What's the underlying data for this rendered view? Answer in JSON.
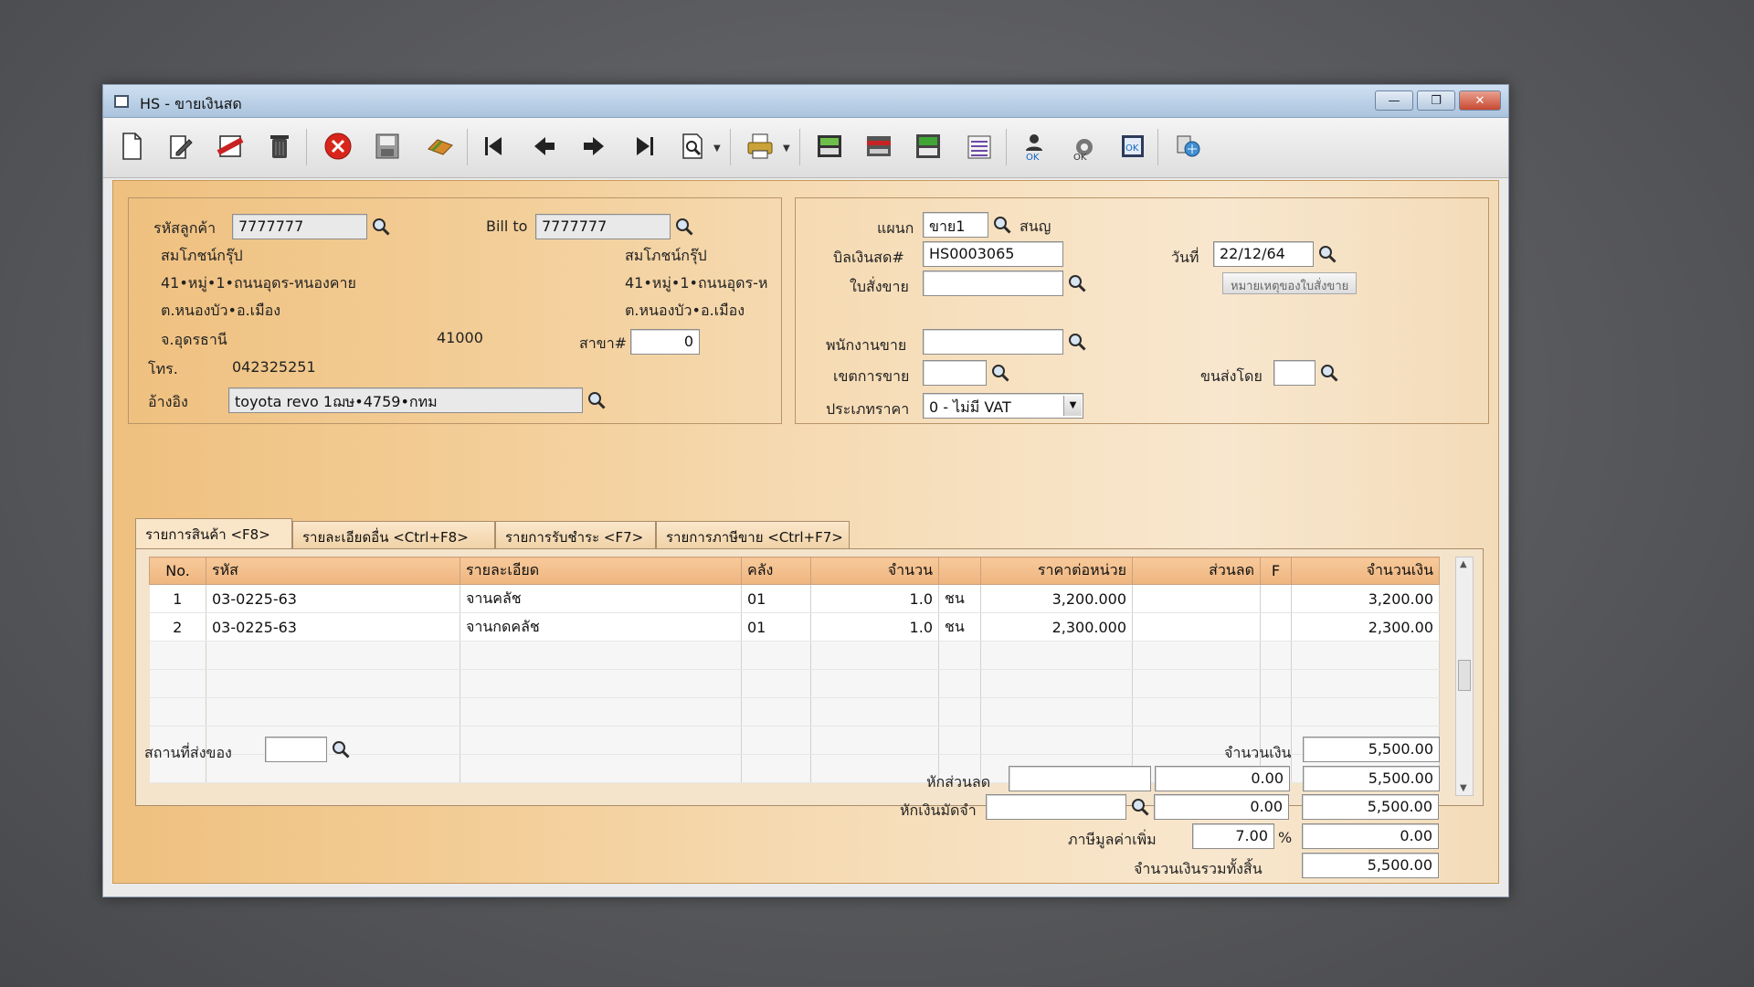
{
  "window": {
    "title": "HS - ขายเงินสด"
  },
  "window_buttons": {
    "minimize": "—",
    "maximize": "❐",
    "close": "✕"
  },
  "customer": {
    "code_label": "รหัสลูกค้า",
    "code": "7777777",
    "name": "สมโภชน์กรุ๊ป",
    "address1": "41•หมู่•1•ถนนอุดร-หนองคาย",
    "address2": "ต.หนองบัว•อ.เมือง",
    "province": "จ.อุดรธานี",
    "postcode": "41000",
    "phone_label": "โทร.",
    "phone": "042325251",
    "ref_label": "อ้างอิง",
    "ref": "toyota revo 1ฌษ•4759•กทม"
  },
  "bill_to": {
    "label": "Bill to",
    "code": "7777777",
    "name": "สมโภชน์กรุ๊ป",
    "address1": "41•หมู่•1•ถนนอุดร-ห",
    "address2": "ต.หนองบัว•อ.เมือง",
    "branch_label": "สาขา#",
    "branch": "0"
  },
  "doc": {
    "dept_label": "แผนก",
    "dept": "ขาย1",
    "dept_name": "สนญ",
    "bill_label": "บิลเงินสด#",
    "bill_no": "HS0003065",
    "date_label": "วันที่",
    "date": "22/12/64",
    "order_label": "ใบสั่งขาย",
    "order": "",
    "order_note_btn": "หมายเหตุของใบสั่งขาย",
    "salesman_label": "พนักงานขาย",
    "salesman": "",
    "area_label": "เขตการขาย",
    "area": "",
    "ship_label": "ขนส่งโดย",
    "ship": "",
    "price_type_label": "ประเภทราคา",
    "price_type": "0 - ไม่มี VAT"
  },
  "tabs": [
    {
      "label": "รายการสินค้า <F8>"
    },
    {
      "label": "รายละเอียดอื่น <Ctrl+F8>"
    },
    {
      "label": "รายการรับชำระ <F7>"
    },
    {
      "label": "รายการภาษีขาย <Ctrl+F7>"
    }
  ],
  "grid": {
    "headers": [
      "No.",
      "รหัส",
      "รายละเอียด",
      "คลัง",
      "จำนวน",
      "",
      "ราคาต่อหน่วย",
      "ส่วนลด",
      "F",
      "จำนวนเงิน"
    ],
    "rows": [
      [
        "1",
        "03-0225-63",
        "จานคลัช",
        "01",
        "1.0",
        "ชน",
        "3,200.000",
        "",
        "",
        "3,200.00"
      ],
      [
        "2",
        "03-0225-63",
        "จานกดคลัช",
        "01",
        "1.0",
        "ชน",
        "2,300.000",
        "",
        "",
        "2,300.00"
      ]
    ]
  },
  "footer": {
    "delivery_label": "สถานที่ส่งของ",
    "delivery": "",
    "amount_label": "จำนวนเงิน",
    "amount": "5,500.00",
    "discount_label": "หักส่วนลด",
    "discount_text": "",
    "discount_value": "0.00",
    "after_discount": "5,500.00",
    "deposit_label": "หักเงินมัดจำ",
    "deposit_text": "",
    "deposit_value": "0.00",
    "after_deposit": "5,500.00",
    "vat_label": "ภาษีมูลค่าเพิ่ม",
    "vat_rate": "7.00",
    "vat_pct": "%",
    "vat_amount": "0.00",
    "total_label": "จำนวนเงินรวมทั้งสิ้น",
    "total": "5,500.00"
  },
  "toolbar_icons": [
    "new-icon",
    "edit-icon",
    "void-icon",
    "delete-icon",
    "cancel-icon",
    "save-icon",
    "approve-icon",
    "first-icon",
    "prev-icon",
    "next-icon",
    "last-icon",
    "search-doc-icon",
    "print-icon",
    "calc-icon",
    "card-icon",
    "report-icon",
    "recalc-icon",
    "user-ok-icon",
    "tool-ok-icon",
    "doc-ok-icon",
    "network-icon"
  ],
  "colors": {
    "accent": "#f3cf9a",
    "cancel": "#d8261c"
  }
}
